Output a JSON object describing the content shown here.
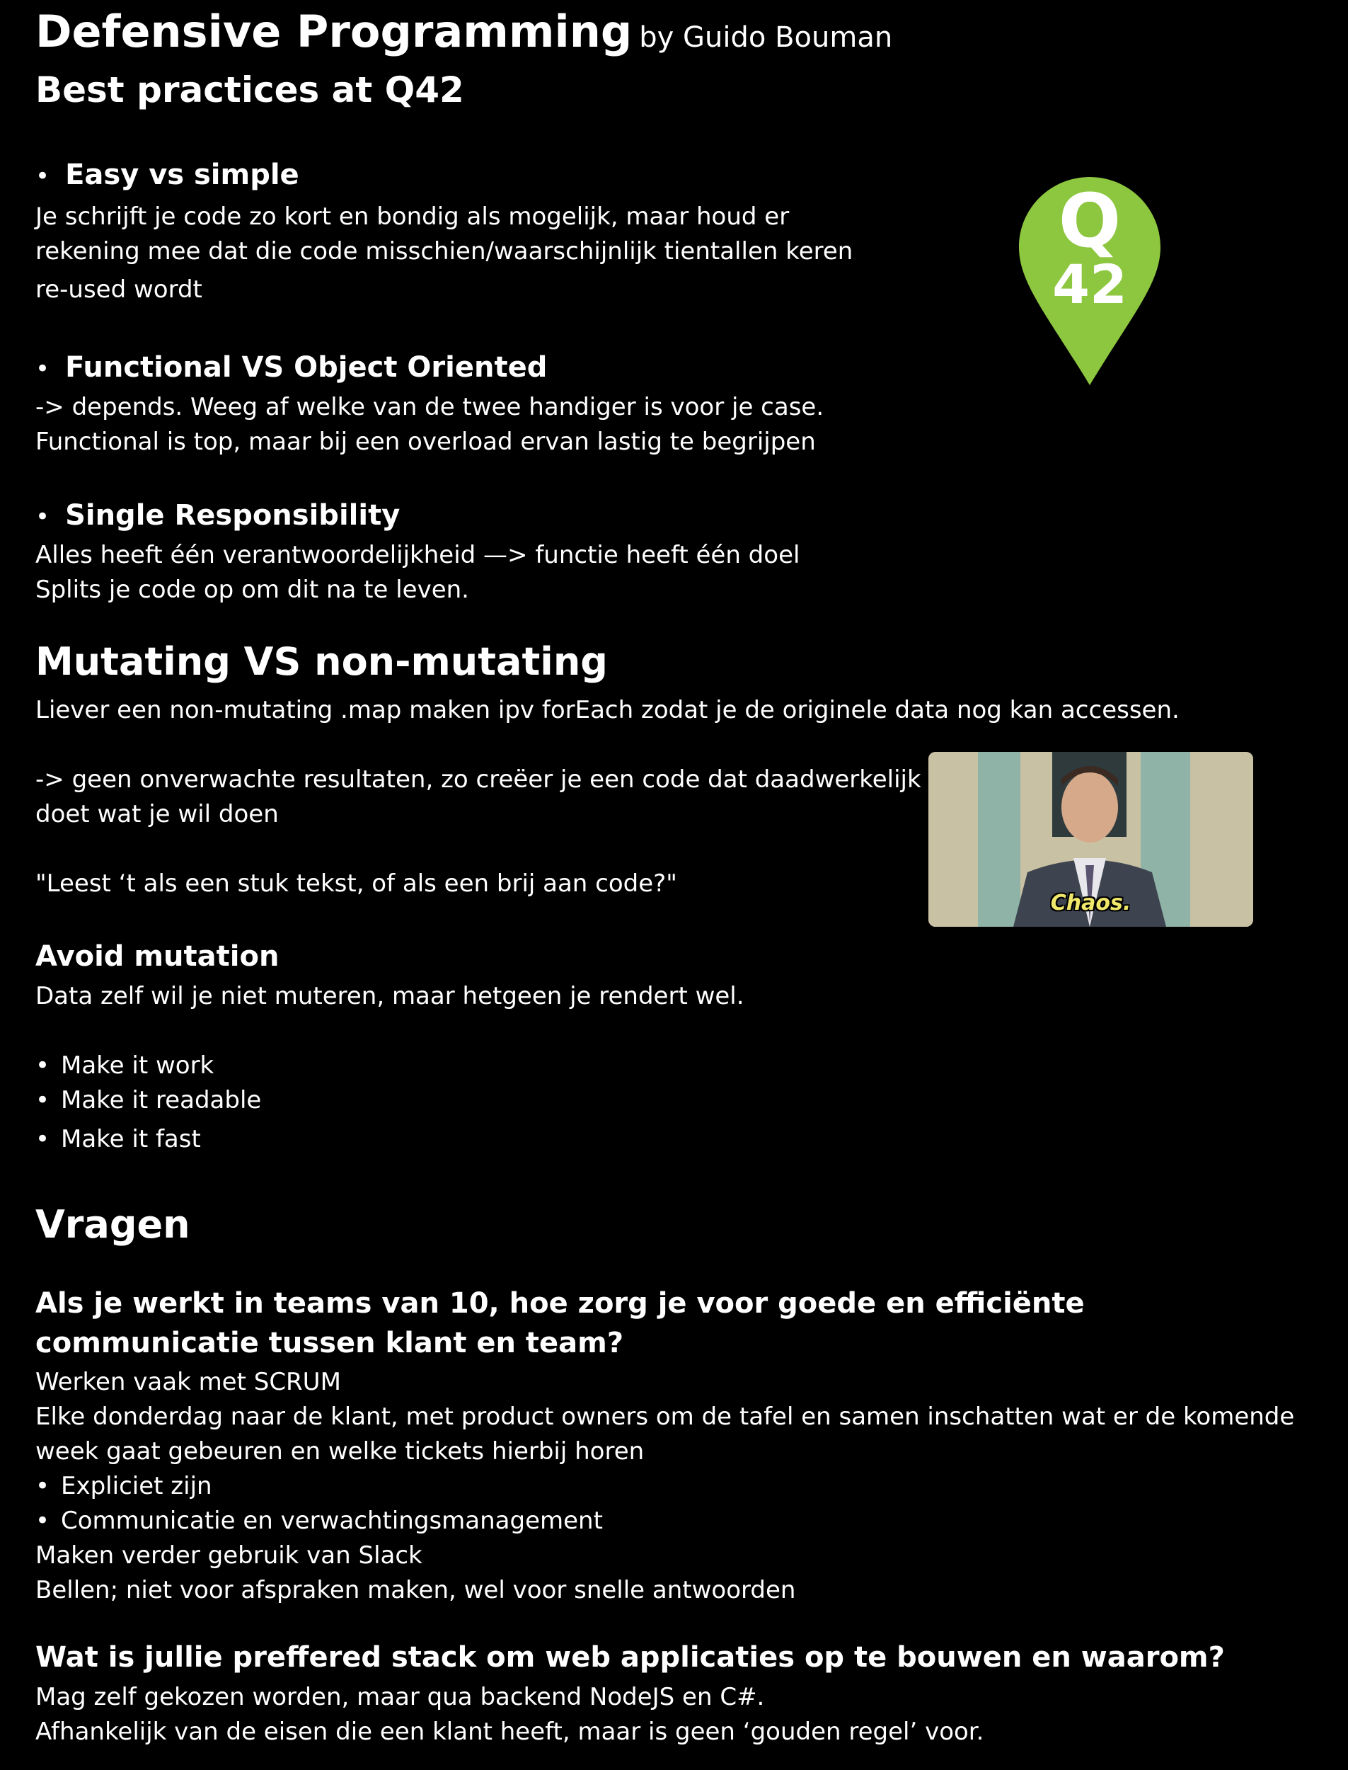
{
  "header": {
    "title": "Defensive Programming",
    "byline": "by Guido Bouman",
    "subtitle": "Best practices at Q42"
  },
  "logo": {
    "letter": "Q",
    "number": "42",
    "color": "#8dc63f"
  },
  "sections": {
    "easy": {
      "heading": "Easy vs simple",
      "lines": [
        "Je schrijft je code zo kort en bondig als mogelijk, maar houd er",
        "rekening mee dat die code misschien/waarschijnlijk tientallen keren",
        "re-used wordt"
      ]
    },
    "functional": {
      "heading": "Functional VS Object Oriented",
      "lines": [
        "-> depends. Weeg af welke van de twee handiger is voor je case.",
        "Functional is top, maar bij een overload ervan lastig te begrijpen"
      ]
    },
    "single": {
      "heading": "Single Responsibility",
      "lines": [
        "Alles heeft één verantwoordelijkheid —>  functie heeft één doel",
        "Splits je code op om dit na te leven."
      ]
    },
    "mutating": {
      "heading": "Mutating VS non-mutating",
      "line1": "Liever een non-mutating .map maken ipv forEach zodat je de originele data nog kan accessen.",
      "line2": "-> geen onverwachte resultaten, zo creëer je een code dat daadwerkelijk",
      "line3": "doet wat je wil doen",
      "quote": "\"Leest ‘t als een stuk tekst, of als een brij aan code?\""
    },
    "avoid": {
      "heading": "Avoid mutation",
      "line": "Data zelf wil je niet muteren, maar hetgeen je rendert wel.",
      "items": [
        "Make it work",
        "Make it readable",
        "Make it fast"
      ]
    },
    "vragen": {
      "heading": "Vragen",
      "q1": {
        "question": "Als je werkt in teams van 10, hoe zorg je voor goede en efficiënte communicatie tussen klant en team?",
        "a1": "Werken vaak met SCRUM",
        "a2": "Elke donderdag naar de klant, met product owners om de tafel en samen inschatten wat er de komende",
        "a3": "week gaat gebeuren en welke tickets hierbij horen",
        "items": [
          "Expliciet zijn",
          "Communicatie en verwachtingsmanagement"
        ],
        "a4": "Maken verder gebruik van Slack",
        "a5": "Bellen; niet voor afspraken maken, wel voor snelle antwoorden"
      },
      "q2": {
        "question": "Wat is jullie preffered stack om web applicaties op te bouwen en waarom?",
        "a1": "Mag zelf gekozen worden, maar qua backend NodeJS en C#.",
        "a2": "Afhankelijk van de eisen die een klant heeft, maar is geen ‘gouden regel’ voor."
      }
    }
  },
  "photo": {
    "caption": "Chaos."
  },
  "bullet": "•"
}
